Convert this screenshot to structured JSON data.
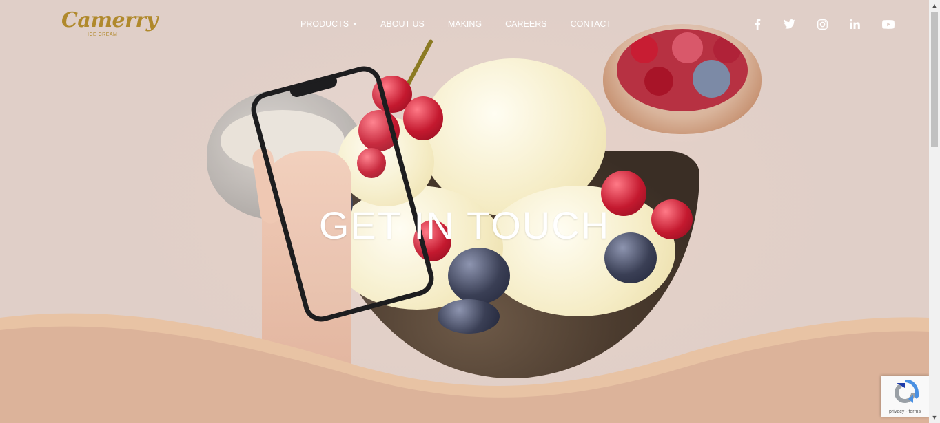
{
  "brand": {
    "name": "Camerry",
    "tagline": "ICE CREAM",
    "color": "#b0892c"
  },
  "nav": {
    "items": [
      {
        "label": "PRODUCTS",
        "has_dropdown": true
      },
      {
        "label": "ABOUT US"
      },
      {
        "label": "MAKING"
      },
      {
        "label": "CAREERS"
      },
      {
        "label": "CONTACT"
      }
    ]
  },
  "social": [
    "facebook-icon",
    "twitter-icon",
    "instagram-icon",
    "linkedin-icon",
    "youtube-icon"
  ],
  "hero": {
    "title": "GET IN TOUCH"
  },
  "recaptcha": {
    "text": "privacy - terms"
  },
  "colors": {
    "wave_light": "#e8c3a4",
    "wave_main": "#dcb39a",
    "white": "#ffffff"
  }
}
